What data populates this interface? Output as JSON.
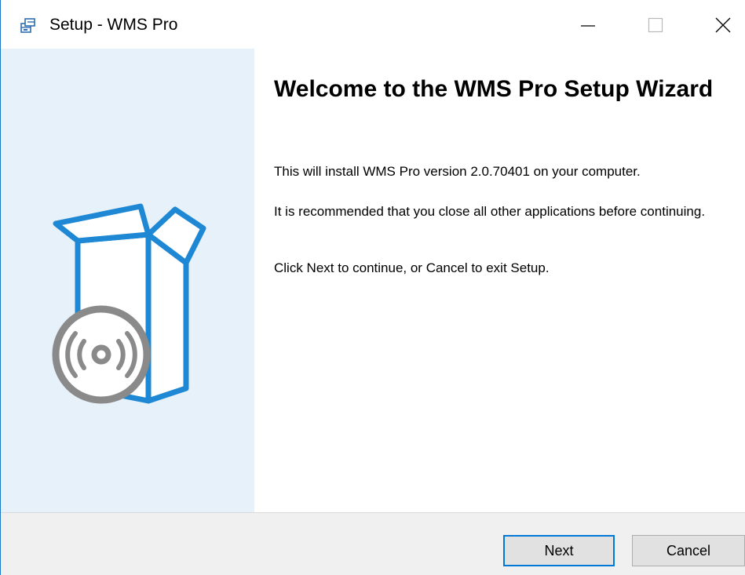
{
  "window": {
    "title": "Setup - WMS Pro"
  },
  "icons": {
    "app": "setup-icon",
    "minimize": "minimize-icon",
    "maximize": "maximize-icon",
    "close": "close-icon",
    "sidebar": "software-box-cd-icon"
  },
  "colors": {
    "accent": "#1e88d4",
    "sidebar_bg": "#e7f1fa",
    "disc": "#8a8a8a",
    "footer_bg": "#f0f0f0",
    "default_button_border": "#0078d7"
  },
  "content": {
    "heading": "Welcome to the WMS Pro Setup Wizard",
    "paragraph_1": "This will install WMS Pro version 2.0.70401 on your computer.",
    "paragraph_2": "It is recommended that you close all other applications before continuing.",
    "paragraph_3": "Click Next to continue, or Cancel to exit Setup."
  },
  "footer": {
    "next_label": "Next",
    "cancel_label": "Cancel"
  }
}
